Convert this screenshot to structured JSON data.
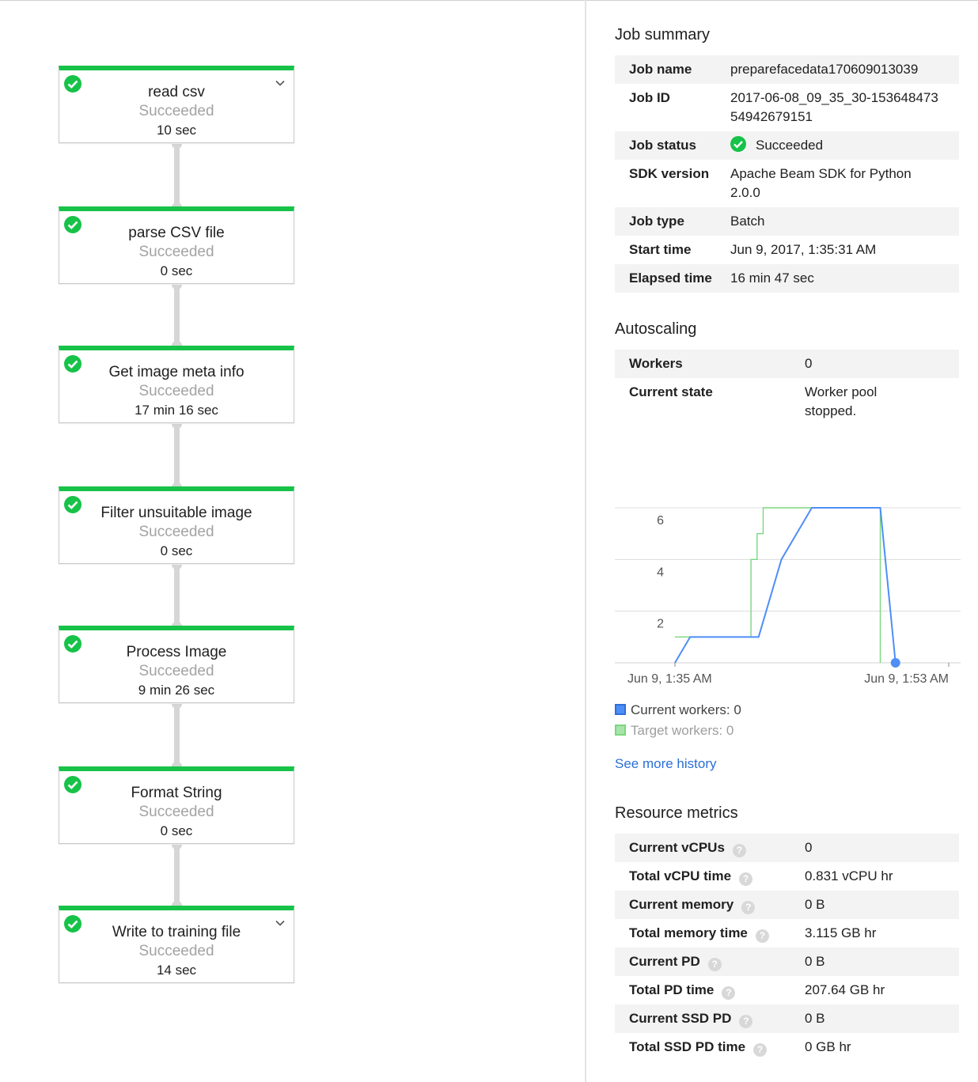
{
  "pipeline": {
    "steps": [
      {
        "name": "read csv",
        "status": "Succeeded",
        "duration": "10 sec",
        "expandable": true
      },
      {
        "name": "parse CSV file",
        "status": "Succeeded",
        "duration": "0 sec",
        "expandable": false
      },
      {
        "name": "Get image meta info",
        "status": "Succeeded",
        "duration": "17 min 16 sec",
        "expandable": false
      },
      {
        "name": "Filter unsuitable image",
        "status": "Succeeded",
        "duration": "0 sec",
        "expandable": false
      },
      {
        "name": "Process Image",
        "status": "Succeeded",
        "duration": "9 min 26 sec",
        "expandable": false
      },
      {
        "name": "Format String",
        "status": "Succeeded",
        "duration": "0 sec",
        "expandable": false
      },
      {
        "name": "Write to training file",
        "status": "Succeeded",
        "duration": "14 sec",
        "expandable": true
      }
    ]
  },
  "job_summary": {
    "title": "Job summary",
    "rows": [
      {
        "label": "Job name",
        "value": "preparefacedata170609013039"
      },
      {
        "label": "Job ID",
        "value": "2017-06-08_09_35_30-15364847354942679151"
      },
      {
        "label": "Job status",
        "value": "Succeeded"
      },
      {
        "label": "SDK version",
        "value": "Apache Beam SDK for Python 2.0.0"
      },
      {
        "label": "Job type",
        "value": "Batch"
      },
      {
        "label": "Start time",
        "value": "Jun 9, 2017, 1:35:31 AM"
      },
      {
        "label": "Elapsed time",
        "value": "16 min 47 sec"
      }
    ]
  },
  "autoscaling": {
    "title": "Autoscaling",
    "rows": [
      {
        "label": "Workers",
        "value": "0"
      },
      {
        "label": "Current state",
        "value": "Worker pool stopped."
      }
    ],
    "legend": {
      "current": "Current workers: 0",
      "target": "Target workers: 0"
    },
    "see_more": "See more history"
  },
  "chart_data": {
    "type": "line",
    "title": "",
    "xlabel": "",
    "ylabel": "",
    "x_tick_labels": [
      "Jun 9, 1:35 AM",
      "Jun 9, 1:53 AM"
    ],
    "y_ticks": [
      2,
      4,
      6
    ],
    "xlim": [
      0,
      18
    ],
    "ylim": [
      0,
      6
    ],
    "grid": true,
    "series": [
      {
        "name": "Current workers",
        "color": "#4e8ef7",
        "x": [
          0,
          1,
          5.5,
          7,
          8,
          9,
          13.5,
          14.5
        ],
        "y": [
          0,
          1,
          1,
          4,
          5,
          6,
          6,
          0
        ]
      },
      {
        "name": "Target workers",
        "color": "#7bd77f",
        "x": [
          0,
          5,
          5,
          5.4,
          5.4,
          5.8,
          5.8,
          13.5,
          13.5
        ],
        "y": [
          1,
          1,
          4,
          4,
          5,
          5,
          6,
          6,
          0
        ]
      }
    ]
  },
  "resource_metrics": {
    "title": "Resource metrics",
    "rows": [
      {
        "label": "Current vCPUs",
        "value": "0"
      },
      {
        "label": "Total vCPU time",
        "value": "0.831 vCPU hr"
      },
      {
        "label": "Current memory",
        "value": "0 B"
      },
      {
        "label": "Total memory time",
        "value": "3.115 GB hr"
      },
      {
        "label": "Current PD",
        "value": "0 B"
      },
      {
        "label": "Total PD time",
        "value": "207.64 GB hr"
      },
      {
        "label": "Current SSD PD",
        "value": "0 B"
      },
      {
        "label": "Total SSD PD time",
        "value": "0 GB hr"
      }
    ],
    "help_glyph": "?"
  },
  "colors": {
    "success": "#17c248",
    "link": "#2a6fd6",
    "current_series": "#4e8ef7",
    "target_series": "#7bd77f"
  },
  "icons": {
    "step_status": "check-circle-icon",
    "expand": "chevron-down-icon",
    "help": "help-icon"
  }
}
